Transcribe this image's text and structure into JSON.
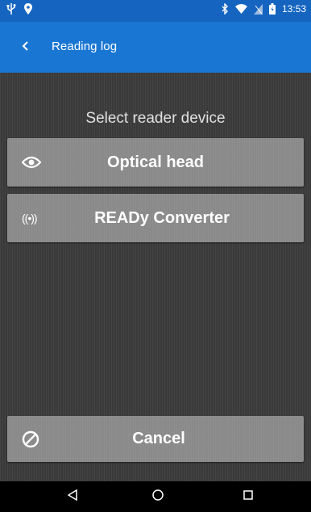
{
  "status_bar": {
    "time": "13:53",
    "icons": [
      "usb-icon",
      "location-pin-icon",
      "bluetooth-icon",
      "wifi-icon",
      "no-sim-icon",
      "battery-icon"
    ]
  },
  "toolbar": {
    "title": "Reading log",
    "back_icon": "chevron-left-icon",
    "color": "#1976d2"
  },
  "main": {
    "heading": "Select reader device",
    "devices": [
      {
        "label": "Optical head",
        "icon": "eye-icon"
      },
      {
        "label": "READy Converter",
        "icon": "radio-waves-icon",
        "icon_glyph": "((•))"
      }
    ],
    "cancel_label": "Cancel",
    "cancel_icon": "prohibited-icon"
  },
  "nav_bar": {
    "buttons": [
      "back-triangle-icon",
      "home-circle-icon",
      "recents-square-icon"
    ]
  },
  "colors": {
    "status_bar": "#1565c0",
    "toolbar": "#1976d2",
    "background": "#3a3a3a",
    "button": "#8a8a8a"
  }
}
